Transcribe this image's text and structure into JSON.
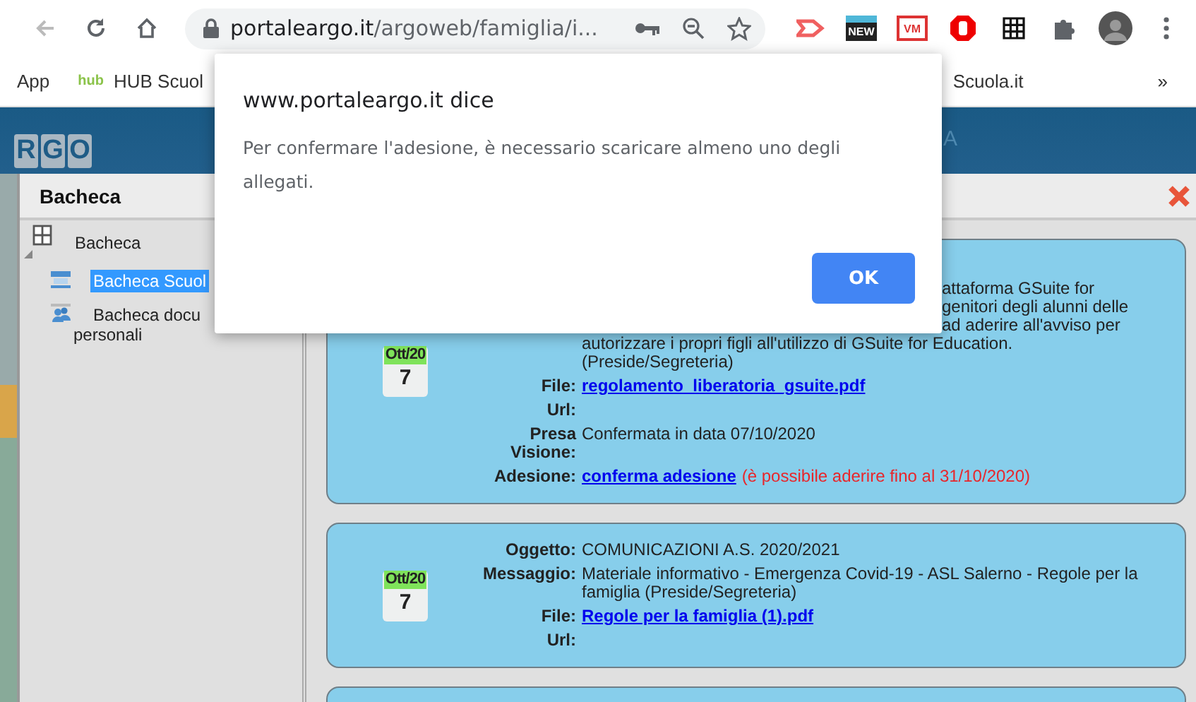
{
  "browser": {
    "back_disabled": true,
    "url_host": "portaleargo.it",
    "url_path": "/argoweb/famiglia/i...",
    "extensions": [
      {
        "kind": "arrow"
      },
      {
        "kind": "badge",
        "label": "NEW"
      },
      {
        "kind": "badge",
        "label": "VM"
      },
      {
        "kind": "stop"
      },
      {
        "kind": "grid"
      },
      {
        "kind": "puzzle"
      },
      {
        "kind": "avatar"
      }
    ],
    "bookmarks": [
      {
        "kind": "apps",
        "label": "App"
      },
      {
        "kind": "hub",
        "logo": "hub",
        "label": "HUB Scuol"
      },
      {
        "kind": "far",
        "label": "Scuola.it"
      }
    ],
    "overflow": "»"
  },
  "header": {
    "logo": [
      "R",
      "G",
      "O"
    ],
    "fragment": "A"
  },
  "window": {
    "title": "Bacheca",
    "tree": {
      "label": "Bacheca",
      "expanded": true,
      "children": [
        {
          "kind": "board",
          "lines": [
            "Bacheca Scuol"
          ],
          "selected": true
        },
        {
          "kind": "people",
          "lines": [
            "Bacheca docu",
            "personali"
          ],
          "selected": false
        }
      ]
    },
    "cards": [
      {
        "month": "Ott/20",
        "day": "7",
        "rows": [
          {
            "kind": "partial",
            "cut_lines": [
              "attaforma GSuite for",
              "genitori degli alunni delle",
              "ad aderire all'avviso per"
            ],
            "lines": [
              "autorizzare i propri figli all'utilizzo di GSuite for Education.",
              "(Preside/Segreteria)"
            ]
          },
          {
            "kind": "link",
            "label": "File:",
            "value": "regolamento_liberatoria_gsuite.pdf"
          },
          {
            "kind": "empty",
            "label": "Url:"
          },
          {
            "kind": "text",
            "label": "Presa Visione:",
            "value": "Confermata in data 07/10/2020"
          },
          {
            "kind": "action",
            "label": "Adesione:",
            "value": "conferma adesione",
            "note": "(è possibile aderire fino al 31/10/2020)"
          }
        ]
      },
      {
        "month": "Ott/20",
        "day": "7",
        "rows": [
          {
            "kind": "text",
            "label": "Oggetto:",
            "value": "COMUNICAZIONI A.S. 2020/2021"
          },
          {
            "kind": "text",
            "label": "Messaggio:",
            "value": "Materiale informativo - Emergenza Covid-19 - ASL Salerno - Regole per la famiglia (Preside/Segreteria)"
          },
          {
            "kind": "link",
            "label": "File:",
            "value": "Regole per la famiglia (1).pdf"
          },
          {
            "kind": "empty",
            "label": "Url:"
          }
        ]
      }
    ]
  },
  "dialog": {
    "title": "www.portaleargo.it dice",
    "message": "Per confermare l'adesione, è necessario scaricare almeno uno degli allegati.",
    "button": "OK"
  }
}
